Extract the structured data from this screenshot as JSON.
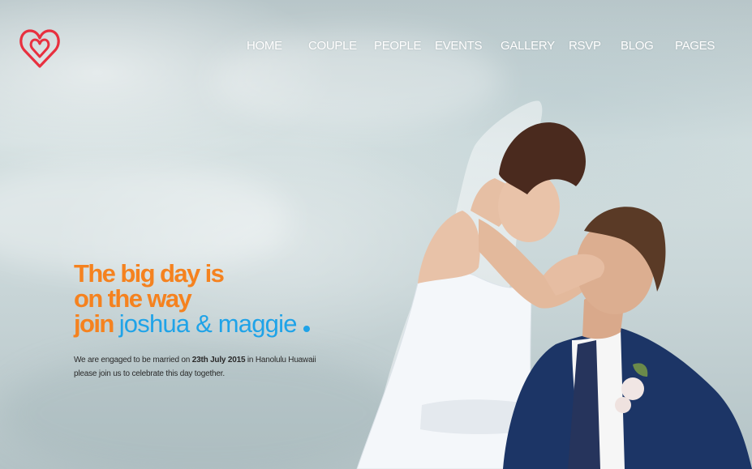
{
  "nav": {
    "items": [
      {
        "label": "HOME"
      },
      {
        "label": "COUPLE"
      },
      {
        "label": "PEOPLE"
      },
      {
        "label": "EVENTS"
      },
      {
        "label": "GALLERY"
      },
      {
        "label": "RSVP"
      },
      {
        "label": "BLOG"
      },
      {
        "label": "PAGES"
      }
    ]
  },
  "logo": {
    "icon": "heart-logo-icon",
    "color": "#e8303f"
  },
  "hero": {
    "line1": "The big day is",
    "line2": "on the way",
    "line3_join": "join",
    "line3_names": "joshua & maggie",
    "desc_prefix": "We are engaged to be married on ",
    "desc_date": "23th July 2015",
    "desc_suffix": " in Hanolulu Huawaii",
    "desc_line2": "please join us to celebrate this day together.",
    "colors": {
      "orange": "#f5821f",
      "blue": "#1fa3e8"
    }
  },
  "photo": {
    "subject": "bride-and-groom-photo"
  }
}
